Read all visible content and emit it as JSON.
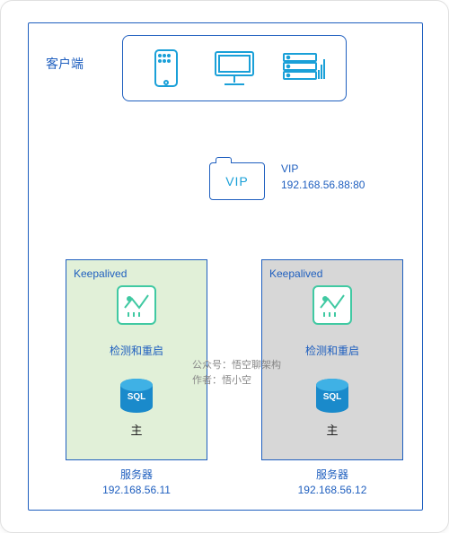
{
  "labels": {
    "client": "客户端",
    "vip": "VIP",
    "vip_addr": "192.168.56.88:80"
  },
  "server_left": {
    "title": "Keepalived",
    "detect": "检测和重启",
    "role": "主",
    "name": "服务器",
    "ip": "192.168.56.11"
  },
  "server_right": {
    "title": "Keepalived",
    "detect": "检测和重启",
    "role": "主",
    "name": "服务器",
    "ip": "192.168.56.12"
  },
  "db": {
    "label": "SQL"
  },
  "attribution": {
    "line1": "公众号：悟空聊架构",
    "line2": "作者：悟小空"
  },
  "colors": {
    "frame": "#1f5fbf",
    "accent": "#1aa0d8",
    "keepalived": "#40c9a2",
    "server_active_bg": "#e1f0d8",
    "server_standby_bg": "#d7d7d7"
  }
}
